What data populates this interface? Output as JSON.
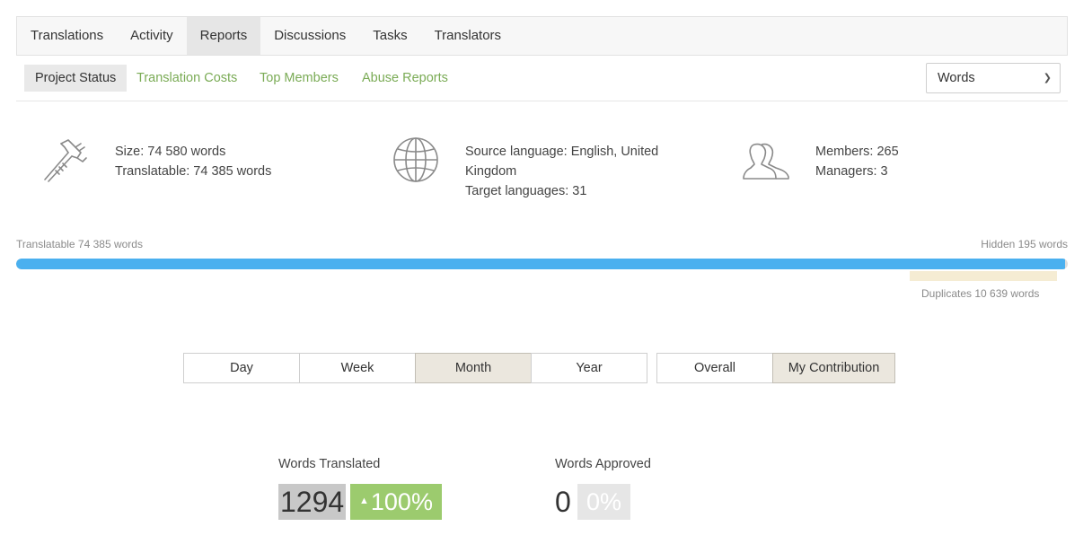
{
  "top_nav": {
    "tabs": [
      "Translations",
      "Activity",
      "Reports",
      "Discussions",
      "Tasks",
      "Translators"
    ],
    "active": "Reports"
  },
  "sub_nav": {
    "tabs": [
      "Project Status",
      "Translation Costs",
      "Top Members",
      "Abuse Reports"
    ],
    "active": "Project Status",
    "unit_select": {
      "selected": "Words"
    }
  },
  "stats": {
    "size": {
      "icon": "caliper-icon",
      "lines": [
        "Size: 74 580 words",
        "Translatable: 74 385 words"
      ]
    },
    "languages": {
      "icon": "globe-icon",
      "lines": [
        "Source language: English, United",
        "Kingdom",
        "Target languages: 31"
      ]
    },
    "members": {
      "icon": "members-icon",
      "lines": [
        "Members: 265",
        "Managers: 3"
      ]
    }
  },
  "progress": {
    "left_label": "Translatable 74 385 words",
    "right_label": "Hidden 195 words",
    "duplicates_label": "Duplicates 10 639 words",
    "translatable_fraction": 0.9974,
    "colors": {
      "translatable": "#4ab0ef",
      "hidden": "#dcdcdc",
      "duplicates": "#f5ecd3"
    }
  },
  "period_buttons": [
    "Day",
    "Week",
    "Month",
    "Year"
  ],
  "period_active": "Month",
  "scope_buttons": [
    "Overall",
    "My Contribution"
  ],
  "scope_active": "My Contribution",
  "metrics": {
    "translated": {
      "label": "Words Translated",
      "value": "1294",
      "change": "100%",
      "change_icon": "triangle-up-icon"
    },
    "approved": {
      "label": "Words Approved",
      "value": "0",
      "change": "0%"
    }
  },
  "colors": {
    "accent_green": "#7aab55",
    "badge_green": "#9ccb6e",
    "active_button": "#ebe7de"
  }
}
